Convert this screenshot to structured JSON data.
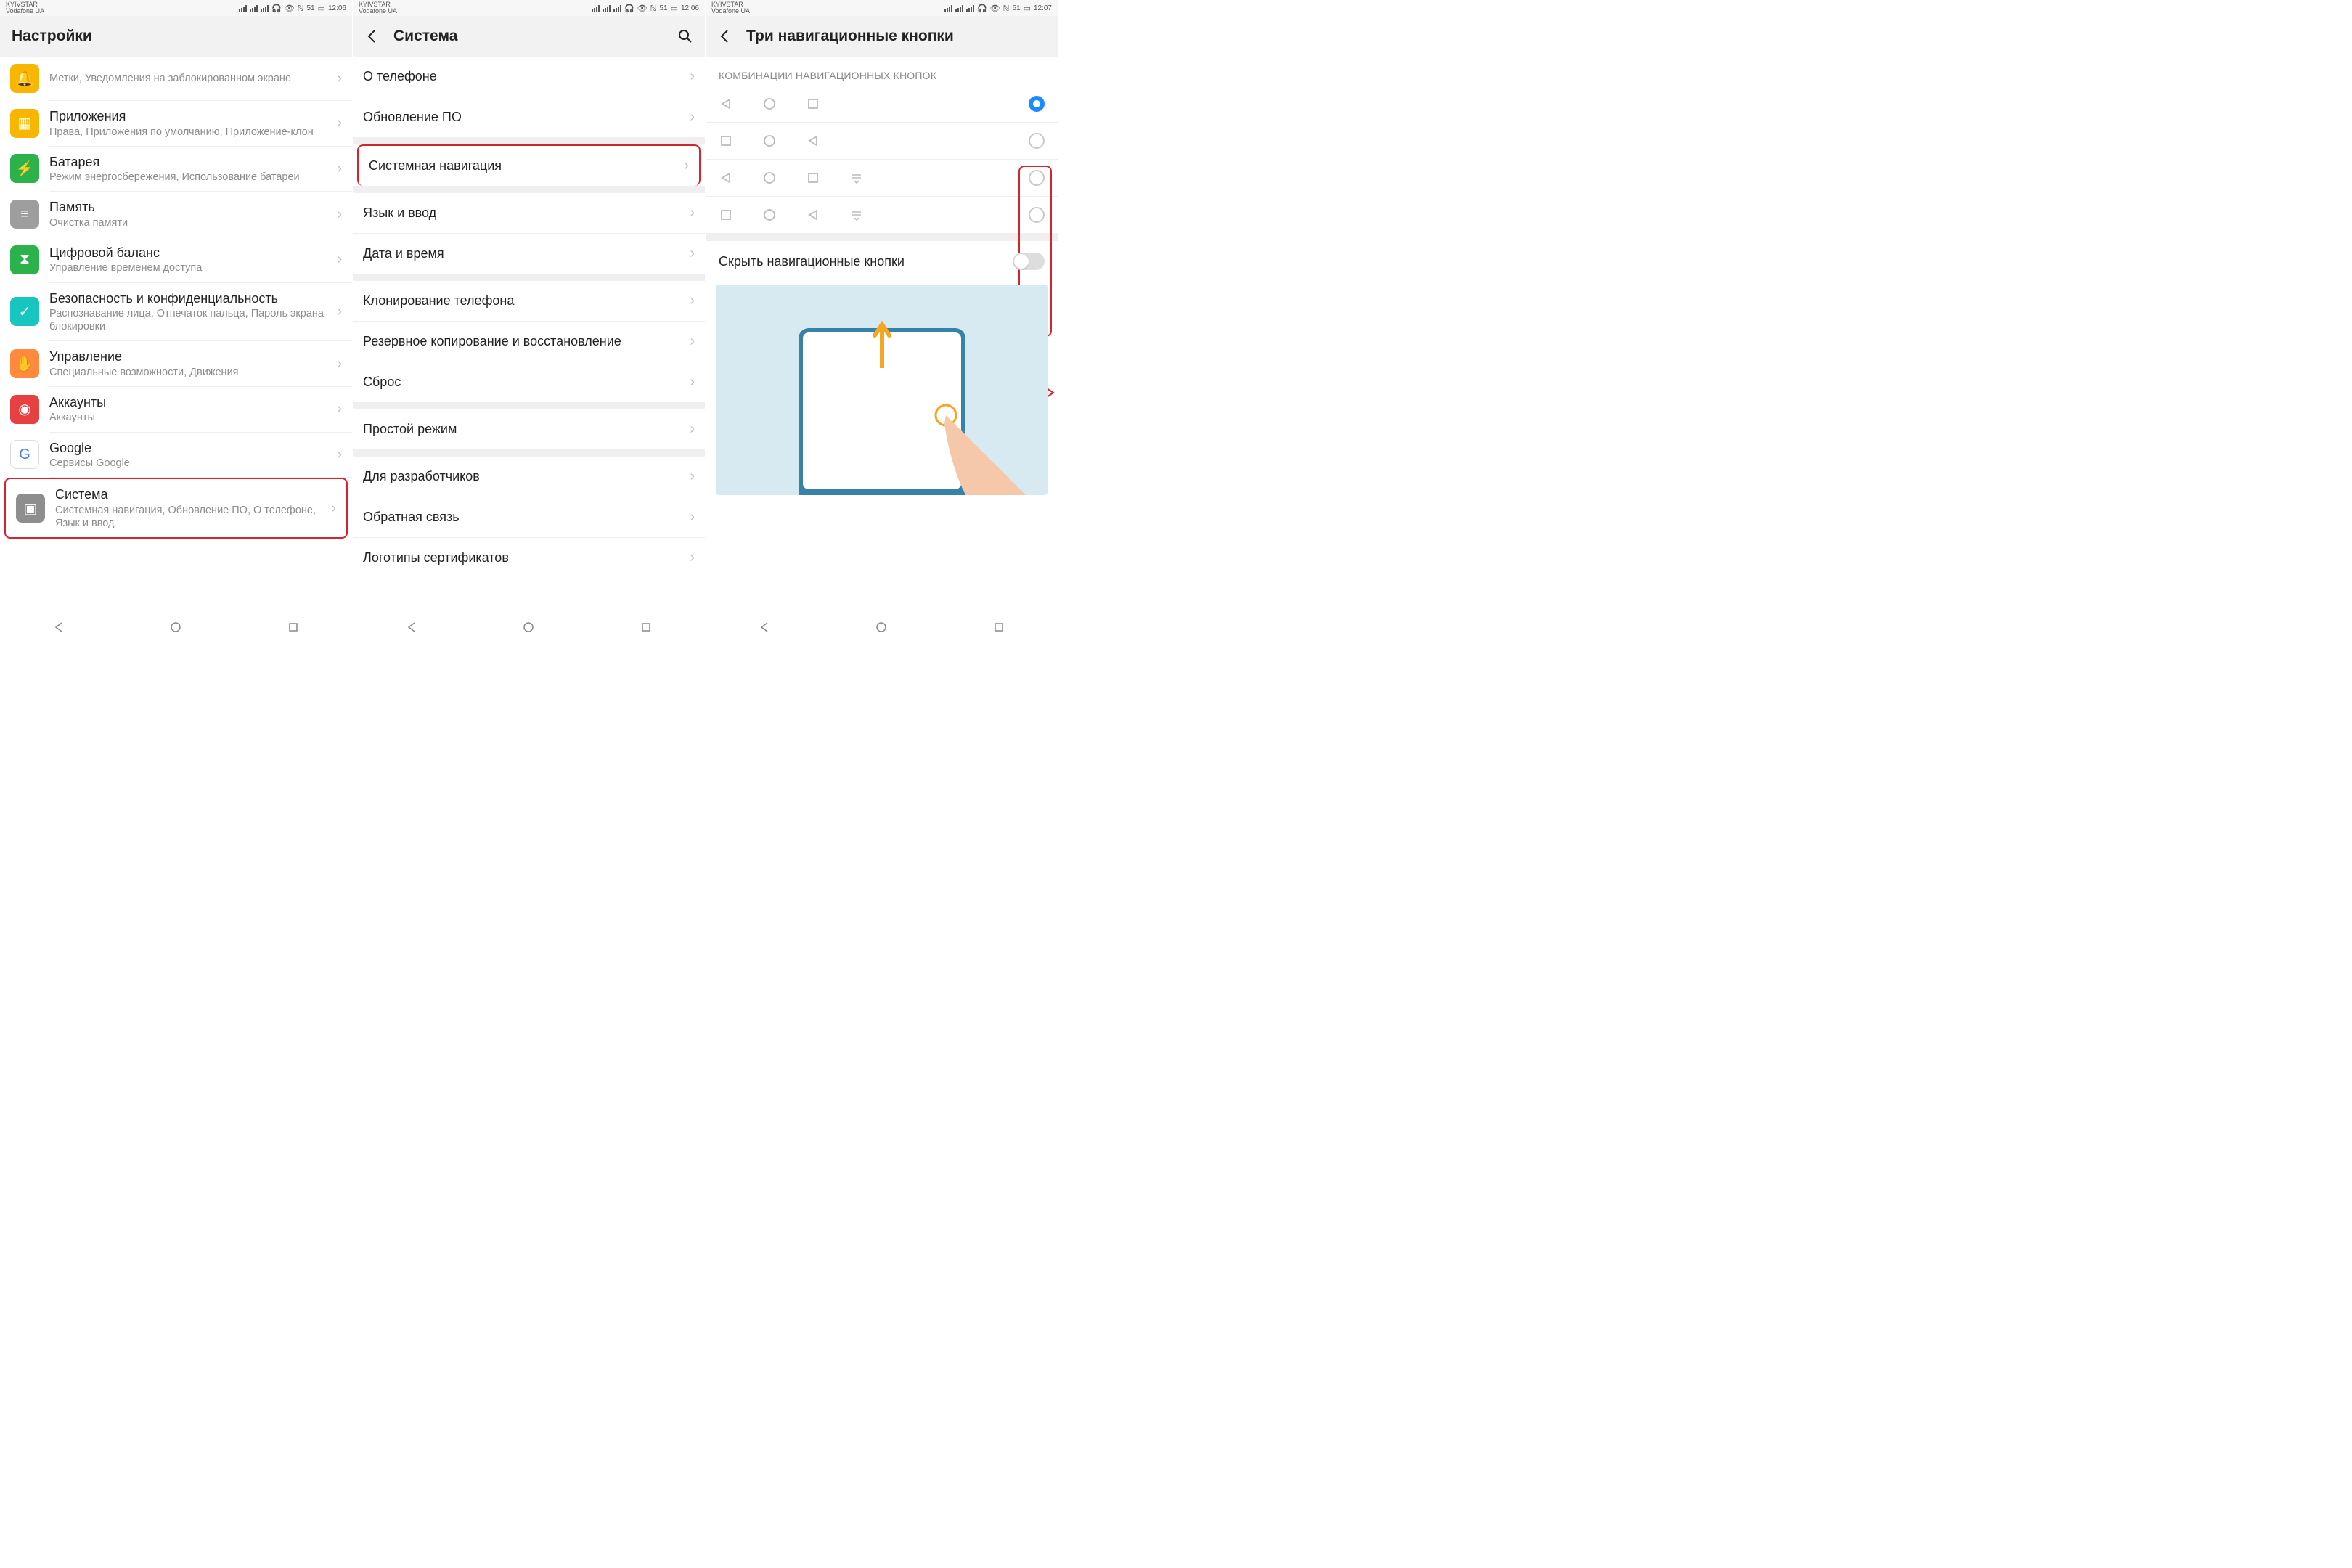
{
  "status": {
    "carrier1": "KYIVSTAR",
    "carrier2": "Vodafone UA",
    "battery": "51",
    "time_a": "12:06",
    "time_b": "12:07"
  },
  "screen1": {
    "title": "Настройки",
    "items": [
      {
        "title": "",
        "sub": "Метки, Уведомления на заблокированном экране",
        "color": "#f9b600"
      },
      {
        "title": "Приложения",
        "sub": "Права, Приложения по умолчанию, Приложение-клон",
        "color": "#f9b600"
      },
      {
        "title": "Батарея",
        "sub": "Режим энергосбережения, Использование батареи",
        "color": "#2bb24b"
      },
      {
        "title": "Память",
        "sub": "Очистка памяти",
        "color": "#9e9e9e"
      },
      {
        "title": "Цифровой баланс",
        "sub": "Управление временем доступа",
        "color": "#2bb24b"
      },
      {
        "title": "Безопасность и конфиденциальность",
        "sub": "Распознавание лица, Отпечаток пальца, Пароль экрана блокировки",
        "color": "#18c6c0"
      },
      {
        "title": "Управление",
        "sub": "Специальные возможности, Движения",
        "color": "#ff8a3d"
      },
      {
        "title": "Аккаунты",
        "sub": "Аккаунты",
        "color": "#e64040"
      },
      {
        "title": "Google",
        "sub": "Сервисы Google",
        "color": "#fff"
      },
      {
        "title": "Система",
        "sub": "Системная навигация, Обновление ПО, О телефоне, Язык и ввод",
        "color": "#8e8e8e"
      }
    ]
  },
  "screen2": {
    "title": "Система",
    "groups": [
      [
        "О телефоне",
        "Обновление ПО"
      ],
      [
        "Системная навигация"
      ],
      [
        "Язык и ввод",
        "Дата и время"
      ],
      [
        "Клонирование телефона",
        "Резервное копирование и восстановление",
        "Сброс"
      ],
      [
        "Простой режим"
      ],
      [
        "Для разработчиков",
        "Обратная связь",
        "Логотипы сертификатов"
      ]
    ]
  },
  "screen3": {
    "title": "Три навигационные кнопки",
    "section": "КОМБИНАЦИИ НАВИГАЦИОННЫХ КНОПОК",
    "hide_label": "Скрыть навигационные кнопки",
    "combos": [
      {
        "icons": [
          "tri",
          "circ",
          "sq"
        ],
        "selected": true
      },
      {
        "icons": [
          "sq",
          "circ",
          "tri"
        ],
        "selected": false
      },
      {
        "icons": [
          "tri",
          "circ",
          "sq",
          "down"
        ],
        "selected": false
      },
      {
        "icons": [
          "sq",
          "circ",
          "tri",
          "down"
        ],
        "selected": false
      }
    ]
  }
}
